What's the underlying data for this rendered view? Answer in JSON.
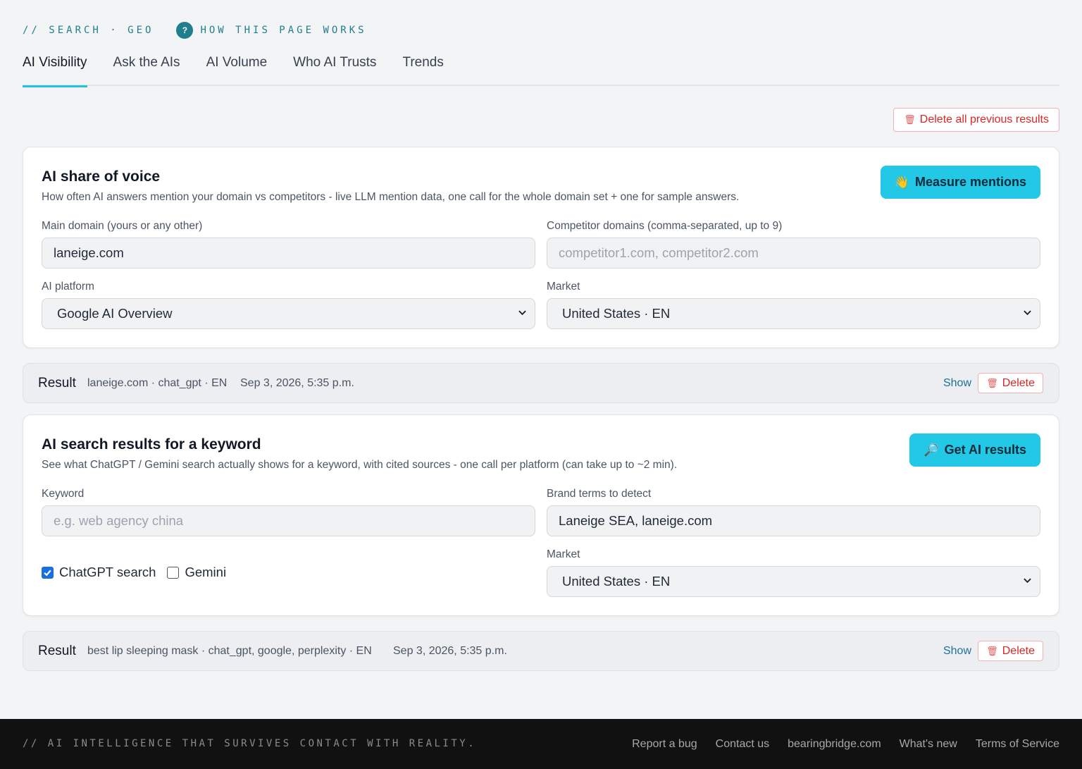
{
  "header": {
    "crumb": "// SEARCH · GEO",
    "help_label": "HOW THIS PAGE WORKS",
    "help_icon": "question-circle-icon"
  },
  "tabs": [
    {
      "label": "AI Visibility",
      "active": true
    },
    {
      "label": "Ask the AIs"
    },
    {
      "label": "AI Volume"
    },
    {
      "label": "Who AI Trusts"
    },
    {
      "label": "Trends"
    }
  ],
  "delete_all_label": "Delete all previous results",
  "share_of_voice": {
    "title": "AI share of voice",
    "description": "How often AI answers mention your domain vs competitors - live LLM mention data, one call for the whole domain set + one for sample answers.",
    "button": "Measure mentions",
    "main_domain_label": "Main domain (yours or any other)",
    "main_domain_value": "laneige.com",
    "competitors_label": "Competitor domains (comma-separated, up to 9)",
    "competitors_placeholder": "competitor1.com, competitor2.com",
    "platform_label": "AI platform",
    "platform_value": "Google AI Overview",
    "market_label": "Market",
    "market_value": "United States · EN"
  },
  "result1": {
    "title": "Result",
    "meta": "laneige.com · chat_gpt · EN",
    "date": "Sep 3, 2026, 5:35 p.m.",
    "show": "Show",
    "delete": "Delete"
  },
  "keyword_search": {
    "title": "AI search results for a keyword",
    "description": "See what ChatGPT / Gemini search actually shows for a keyword, with cited sources - one call per platform (can take up to ~2 min).",
    "button": "Get AI results",
    "keyword_label": "Keyword",
    "keyword_placeholder": "e.g. web agency china",
    "brand_label": "Brand terms to detect",
    "brand_value": "Laneige SEA, laneige.com",
    "chatgpt_label": "ChatGPT search",
    "chatgpt_checked": true,
    "gemini_label": "Gemini",
    "gemini_checked": false,
    "market_label": "Market",
    "market_value": "United States · EN"
  },
  "result2": {
    "title": "Result",
    "meta": "best lip sleeping mask · chat_gpt, google, perplexity · EN",
    "date": "Sep 3, 2026, 5:35 p.m.",
    "show": "Show",
    "delete": "Delete"
  },
  "footer": {
    "tagline": "// AI INTELLIGENCE THAT SURVIVES CONTACT WITH REALITY.",
    "links": [
      "Report a bug",
      "Contact us",
      "bearingbridge.com",
      "What's new",
      "Terms of Service"
    ]
  },
  "colors": {
    "accent": "#22c8e5",
    "brand_teal": "#1f7f8c",
    "danger": "#dc2626"
  }
}
